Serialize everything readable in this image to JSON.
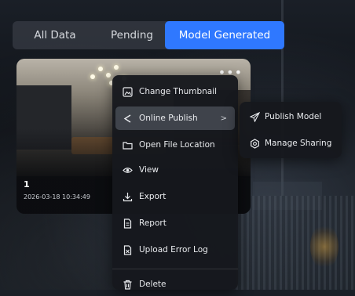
{
  "tabs": [
    {
      "label": "All Data",
      "active": false
    },
    {
      "label": "Pending",
      "active": false
    },
    {
      "label": "Model Generated",
      "active": true
    }
  ],
  "colors": {
    "accent": "#2f78ff",
    "menu_bg": "#16181d",
    "active_item_bg": "#464b54"
  },
  "card": {
    "name": "1",
    "timestamp": "2026-03-18 10:34:49",
    "more_icon": "more-dots-icon"
  },
  "context_menu": {
    "items": [
      {
        "label": "Change Thumbnail",
        "icon": "image-icon"
      },
      {
        "label": "Online Publish",
        "icon": "share-icon",
        "has_submenu": true,
        "active": true
      },
      {
        "label": "Open File Location",
        "icon": "folder-icon"
      },
      {
        "label": "View",
        "icon": "eye-icon"
      },
      {
        "label": "Export",
        "icon": "download-icon"
      },
      {
        "label": "Report",
        "icon": "report-icon"
      },
      {
        "label": "Upload Error Log",
        "icon": "error-log-icon"
      },
      {
        "label": "Delete",
        "icon": "trash-icon"
      }
    ],
    "submenu_arrow": ">"
  },
  "submenu": {
    "items": [
      {
        "label": "Publish Model",
        "icon": "send-icon"
      },
      {
        "label": "Manage Sharing",
        "icon": "gear-icon"
      }
    ]
  }
}
